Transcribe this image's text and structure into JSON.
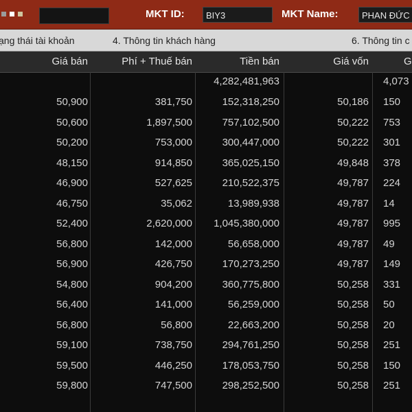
{
  "header": {
    "account_field_value": "",
    "mkt_id_label": "MKT ID:",
    "mkt_id_value": "BIY3",
    "mkt_name_label": "MKT Name:",
    "mkt_name_value": "PHAN ĐỨC",
    "accent_color": "#8f2a16"
  },
  "tabs": [
    {
      "label": "ạng thái tài khoản"
    },
    {
      "label": "4. Thông tin khách hàng"
    },
    {
      "label": "6. Thông tin c"
    }
  ],
  "table": {
    "columns": [
      "Giá bán",
      "Phí + Thuế bán",
      "Tiền bán",
      "Giá vốn",
      "G"
    ],
    "total": {
      "tien_ban": "4,282,481,963",
      "next_col": "4,073"
    },
    "rows": [
      {
        "gia_ban": "50,900",
        "phi_thue": "381,750",
        "tien_ban": "152,318,250",
        "gia_von": "50,186",
        "next": "150"
      },
      {
        "gia_ban": "50,600",
        "phi_thue": "1,897,500",
        "tien_ban": "757,102,500",
        "gia_von": "50,222",
        "next": "753"
      },
      {
        "gia_ban": "50,200",
        "phi_thue": "753,000",
        "tien_ban": "300,447,000",
        "gia_von": "50,222",
        "next": "301"
      },
      {
        "gia_ban": "48,150",
        "phi_thue": "914,850",
        "tien_ban": "365,025,150",
        "gia_von": "49,848",
        "next": "378"
      },
      {
        "gia_ban": "46,900",
        "phi_thue": "527,625",
        "tien_ban": "210,522,375",
        "gia_von": "49,787",
        "next": "224"
      },
      {
        "gia_ban": "46,750",
        "phi_thue": "35,062",
        "tien_ban": "13,989,938",
        "gia_von": "49,787",
        "next": "14"
      },
      {
        "gia_ban": "52,400",
        "phi_thue": "2,620,000",
        "tien_ban": "1,045,380,000",
        "gia_von": "49,787",
        "next": "995"
      },
      {
        "gia_ban": "56,800",
        "phi_thue": "142,000",
        "tien_ban": "56,658,000",
        "gia_von": "49,787",
        "next": "49"
      },
      {
        "gia_ban": "56,900",
        "phi_thue": "426,750",
        "tien_ban": "170,273,250",
        "gia_von": "49,787",
        "next": "149"
      },
      {
        "gia_ban": "54,800",
        "phi_thue": "904,200",
        "tien_ban": "360,775,800",
        "gia_von": "50,258",
        "next": "331"
      },
      {
        "gia_ban": "56,400",
        "phi_thue": "141,000",
        "tien_ban": "56,259,000",
        "gia_von": "50,258",
        "next": "50"
      },
      {
        "gia_ban": "56,800",
        "phi_thue": "56,800",
        "tien_ban": "22,663,200",
        "gia_von": "50,258",
        "next": "20"
      },
      {
        "gia_ban": "59,100",
        "phi_thue": "738,750",
        "tien_ban": "294,761,250",
        "gia_von": "50,258",
        "next": "251"
      },
      {
        "gia_ban": "59,500",
        "phi_thue": "446,250",
        "tien_ban": "178,053,750",
        "gia_von": "50,258",
        "next": "150"
      },
      {
        "gia_ban": "59,800",
        "phi_thue": "747,500",
        "tien_ban": "298,252,500",
        "gia_von": "50,258",
        "next": "251"
      }
    ]
  }
}
